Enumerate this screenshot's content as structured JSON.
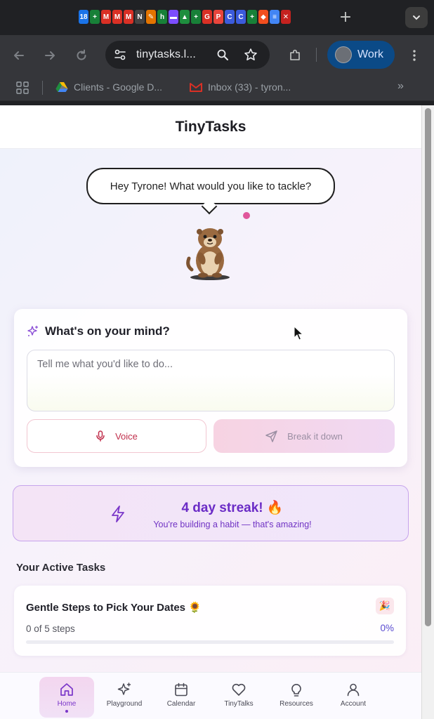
{
  "browser": {
    "url_display": "tinytasks.l...",
    "profile_label": "Work",
    "tab_favicons": [
      {
        "icon": "calendar-icon",
        "glyph": "18",
        "color": "#1a73e8"
      },
      {
        "icon": "sheets-plus-icon",
        "glyph": "+",
        "color": "#188038"
      },
      {
        "icon": "gmail-icon",
        "glyph": "M",
        "color": "#d93025"
      },
      {
        "icon": "gmail-icon",
        "glyph": "M",
        "color": "#d93025"
      },
      {
        "icon": "gmail-icon",
        "glyph": "M",
        "color": "#d93025"
      },
      {
        "icon": "notion-icon",
        "glyph": "N",
        "color": "#444444"
      },
      {
        "icon": "pencil-icon",
        "glyph": "✎",
        "color": "#e37400"
      },
      {
        "icon": "app-icon",
        "glyph": "h",
        "color": "#188038"
      },
      {
        "icon": "slides-icon",
        "glyph": "▬",
        "color": "#7c4dff"
      },
      {
        "icon": "drive-icon",
        "glyph": "▲",
        "color": "#1e8e3e"
      },
      {
        "icon": "sheets-plus-icon",
        "glyph": "+",
        "color": "#188038"
      },
      {
        "icon": "grammarly-icon",
        "glyph": "G",
        "color": "#d93025"
      },
      {
        "icon": "p-icon",
        "glyph": "P",
        "color": "#e8453c"
      },
      {
        "icon": "c-icon",
        "glyph": "C",
        "color": "#3b5bdb"
      },
      {
        "icon": "c-icon",
        "glyph": "C",
        "color": "#3b5bdb"
      },
      {
        "icon": "sheets-plus-icon",
        "glyph": "+",
        "color": "#188038"
      },
      {
        "icon": "figma-icon",
        "glyph": "◆",
        "color": "#f24e1e"
      },
      {
        "icon": "forms-icon",
        "glyph": "≡",
        "color": "#4285f4"
      },
      {
        "icon": "close-icon",
        "glyph": "✕",
        "color": "#c5221f"
      }
    ]
  },
  "bookmarks": [
    {
      "label": "Clients - Google D...",
      "icon": "google-drive-icon"
    },
    {
      "label": "Inbox (33) - tyron...",
      "icon": "gmail-icon"
    }
  ],
  "app": {
    "title": "TinyTasks",
    "greeting": "Hey Tyrone! What would you like to tackle?",
    "mind_card": {
      "title": "What's on your mind?",
      "placeholder": "Tell me what you'd like to do...",
      "voice_label": "Voice",
      "break_label": "Break it down"
    },
    "streak": {
      "title": "4 day streak! 🔥",
      "subtitle": "You're building a habit — that's amazing!"
    },
    "active_tasks_title": "Your Active Tasks",
    "tasks": [
      {
        "name": "Gentle Steps to Pick Your Dates 🌻",
        "badge": "🎉",
        "steps": "0 of 5 steps",
        "percent_label": "0%",
        "progress": 0
      }
    ],
    "nav": [
      {
        "label": "Home",
        "icon": "home-icon",
        "active": true
      },
      {
        "label": "Playground",
        "icon": "sparkles-icon",
        "active": false
      },
      {
        "label": "Calendar",
        "icon": "calendar-icon",
        "active": false
      },
      {
        "label": "TinyTalks",
        "icon": "heart-icon",
        "active": false
      },
      {
        "label": "Resources",
        "icon": "lightbulb-icon",
        "active": false
      },
      {
        "label": "Account",
        "icon": "user-icon",
        "active": false
      }
    ],
    "colors": {
      "accent_purple": "#6b2cc6",
      "voice_red": "#c02d4a",
      "pink_dot": "#e0569b"
    }
  }
}
